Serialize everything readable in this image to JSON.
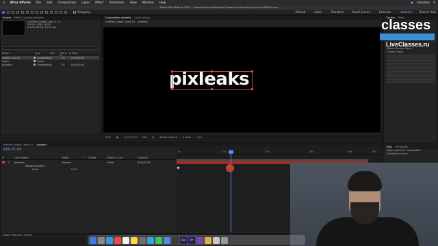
{
  "menubar": {
    "app": "After Effects",
    "items": [
      "File",
      "Edit",
      "Composition",
      "Layer",
      "Effect",
      "Animation",
      "View",
      "Window",
      "Help"
    ],
    "user": "nitrozme"
  },
  "title": "Adobe After Effects 2020 - /Users/nitrozme/Desktop/Creators/ae Recordings/-ret-and FR/title.aep",
  "toolbar": {
    "snapping": "Snapping",
    "workspaces": [
      "Default",
      "Learn",
      "Standard",
      "Small Screen",
      "Libraries",
      "nitrozme"
    ],
    "search_help": "Search Help"
  },
  "project": {
    "tabs": [
      "Project",
      "Effect Controls pixleaks"
    ],
    "comp_name": "Untitled Linked Comp 01 ▾",
    "comp_dims": "1920 x 1080 (1.00)",
    "comp_dur": "Δ 0;00;30;00, 25.00 fps",
    "columns": [
      "Name",
      "Type",
      "Size",
      "Frame Ra...",
      "In Point"
    ],
    "rows": [
      {
        "name": "Untitle...mp 01",
        "type": "Composition",
        "fps": "25",
        "in": "0;00;00;00",
        "color": "#9b9bd6"
      },
      {
        "name": "Solids",
        "type": "Folder",
        "fps": "",
        "in": "",
        "color": "#d9b35a"
      },
      {
        "name": "pixleaks",
        "type": "Composition",
        "fps": "25",
        "in": "0;00;00;00",
        "color": "#9b9bd6"
      }
    ]
  },
  "comp": {
    "tab": "Composition pixleaks",
    "layer_tab": "Layer (none)",
    "subtabs": [
      "Untitled Linked Comp 01",
      "pixleaks"
    ],
    "canvas_text": "pixleaks",
    "bar": {
      "zoom": "50%",
      "time": "0;00;01;04",
      "quality": "Full",
      "camera": "Active Camera",
      "view": "1 View",
      "offset": "+0.0"
    }
  },
  "right": {
    "tabs": [
      "Tracker",
      "Paint"
    ],
    "tracker_items": [
      "Track Camera",
      "Warp Stabilizer",
      "Track Motion",
      "Stabilize Motion"
    ],
    "motion_source": "Motion Source:",
    "motion_source_val": "None",
    "current_track": "Current Track:",
    "align_tab": "Align",
    "paragraph_tab": "Paragraph",
    "align_to": "Align Layers to:",
    "align_val": "Composition",
    "distribute": "Distribute Layers:"
  },
  "logo": {
    "main": "classes",
    "sub": "LiveClasses.ru"
  },
  "timeline": {
    "tabs": [
      "Untitled Linked Comp 01",
      "pixleaks"
    ],
    "timecode": "0;00;01;04",
    "columns": [
      "#",
      "Layer Name",
      "Mode",
      "T",
      "TrkMat",
      "Parent & Link",
      "Duration"
    ],
    "rows": [
      {
        "num": "1",
        "name": "pixleaks",
        "mode": "Normal",
        "parent": "None",
        "duration": "0;00;03;00"
      },
      {
        "num": "",
        "name": "Range Selector 1",
        "mode": "",
        "parent": "",
        "duration": ""
      },
      {
        "num": "",
        "name": "Start",
        "mode": "",
        "parent": "",
        "duration": "100%"
      }
    ],
    "ruler": [
      "0s",
      "01s",
      "02s",
      "03s",
      "04s",
      "05s"
    ],
    "bottom": "Toggle Switches / Modes"
  },
  "motion2": {
    "title": "Motion 2",
    "val": "Motion v2"
  },
  "colors": {
    "accent": "#4d8dff",
    "layer_bar": "#a52a2a",
    "selection": "#d14a4a"
  }
}
